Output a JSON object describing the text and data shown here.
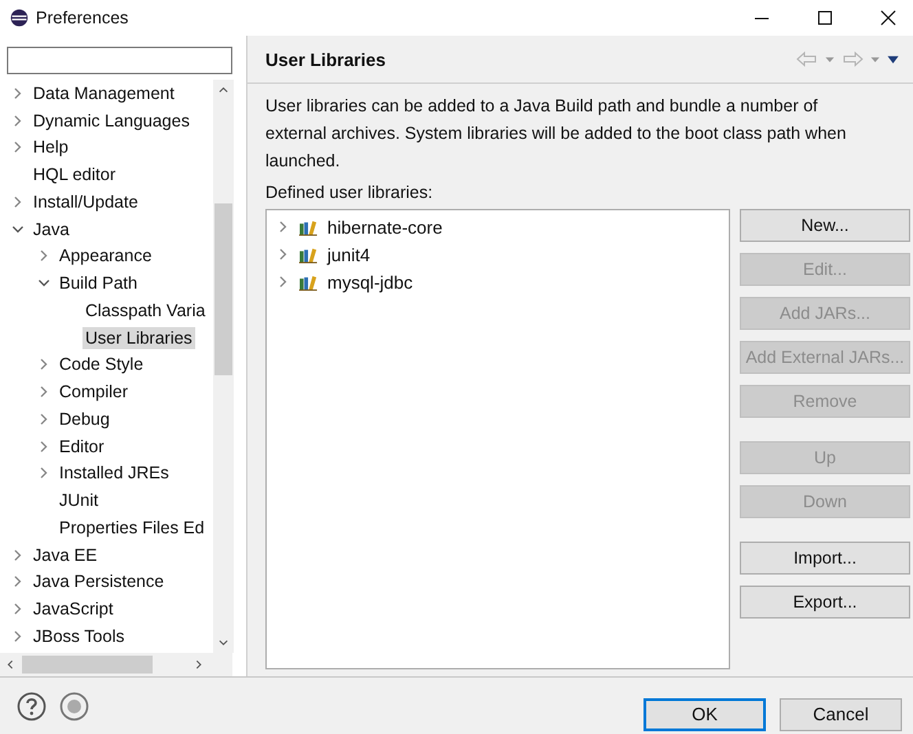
{
  "window": {
    "title": "Preferences"
  },
  "tree": [
    {
      "label": "Data Management",
      "kind": "node",
      "expanded": false,
      "selected": false
    },
    {
      "label": "Dynamic Languages",
      "kind": "node",
      "expanded": false,
      "selected": false
    },
    {
      "label": "Help",
      "kind": "node",
      "expanded": false,
      "selected": false
    },
    {
      "label": "HQL editor",
      "kind": "leaf",
      "selected": false
    },
    {
      "label": "Install/Update",
      "kind": "node",
      "expanded": false,
      "selected": false
    },
    {
      "label": "Java",
      "kind": "node",
      "expanded": true,
      "selected": false,
      "children": [
        {
          "label": "Appearance",
          "kind": "node",
          "expanded": false,
          "selected": false
        },
        {
          "label": "Build Path",
          "kind": "node",
          "expanded": true,
          "selected": false,
          "children": [
            {
              "label": "Classpath Varia",
              "kind": "leaf",
              "selected": false
            },
            {
              "label": "User Libraries",
              "kind": "leaf",
              "selected": true
            }
          ]
        },
        {
          "label": "Code Style",
          "kind": "node",
          "expanded": false,
          "selected": false
        },
        {
          "label": "Compiler",
          "kind": "node",
          "expanded": false,
          "selected": false
        },
        {
          "label": "Debug",
          "kind": "node",
          "expanded": false,
          "selected": false
        },
        {
          "label": "Editor",
          "kind": "node",
          "expanded": false,
          "selected": false
        },
        {
          "label": "Installed JREs",
          "kind": "node",
          "expanded": false,
          "selected": false
        },
        {
          "label": "JUnit",
          "kind": "leaf",
          "selected": false
        },
        {
          "label": "Properties Files Ed",
          "kind": "leaf",
          "selected": false
        }
      ]
    },
    {
      "label": "Java EE",
      "kind": "node",
      "expanded": false,
      "selected": false
    },
    {
      "label": "Java Persistence",
      "kind": "node",
      "expanded": false,
      "selected": false
    },
    {
      "label": "JavaScript",
      "kind": "node",
      "expanded": false,
      "selected": false
    },
    {
      "label": "JBoss Tools",
      "kind": "node",
      "expanded": false,
      "selected": false
    }
  ],
  "page": {
    "title": "User Libraries",
    "description": "User libraries can be added to a Java Build path and bundle a number of external archives. System libraries will be added to the boot class path when launched.",
    "list_label": "Defined user libraries:",
    "libraries": [
      {
        "label": "hibernate-core",
        "expanded": false
      },
      {
        "label": "junit4",
        "expanded": false
      },
      {
        "label": "mysql-jdbc",
        "expanded": false
      }
    ],
    "button_groups": [
      [
        {
          "label": "New...",
          "disabled": false
        },
        {
          "label": "Edit...",
          "disabled": true
        },
        {
          "label": "Add JARs...",
          "disabled": true
        },
        {
          "label": "Add External JARs...",
          "disabled": true
        },
        {
          "label": "Remove",
          "disabled": true
        }
      ],
      [
        {
          "label": "Up",
          "disabled": true
        },
        {
          "label": "Down",
          "disabled": true
        }
      ],
      [
        {
          "label": "Import...",
          "disabled": false
        },
        {
          "label": "Export...",
          "disabled": false
        }
      ]
    ]
  },
  "footer": {
    "buttons": [
      {
        "label": "OK",
        "default": true
      },
      {
        "label": "Cancel",
        "default": false
      }
    ]
  }
}
